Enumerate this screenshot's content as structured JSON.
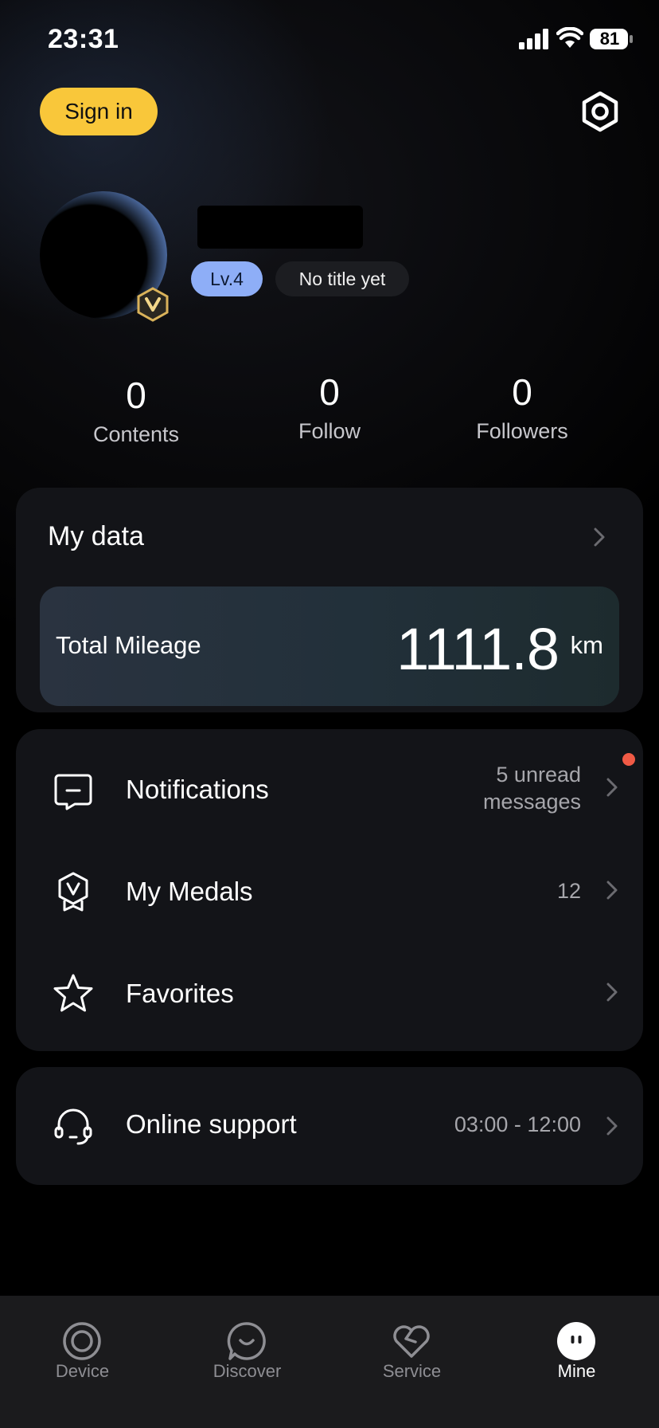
{
  "status_bar": {
    "time": "23:31",
    "battery": "81"
  },
  "header": {
    "sign_in_label": "Sign in",
    "settings_icon": "settings-icon"
  },
  "profile": {
    "level": "Lv.4",
    "title": "No title yet"
  },
  "stats": [
    {
      "value": "0",
      "label": "Contents"
    },
    {
      "value": "0",
      "label": "Follow"
    },
    {
      "value": "0",
      "label": "Followers"
    }
  ],
  "my_data": {
    "title": "My data",
    "mileage_label": "Total Mileage",
    "mileage_value": "1111.8",
    "mileage_unit": "km"
  },
  "menu": {
    "notifications": {
      "label": "Notifications",
      "value_line1": "5 unread",
      "value_line2": "messages",
      "icon": "message-icon",
      "has_unread_dot": true
    },
    "medals": {
      "label": "My Medals",
      "value": "12",
      "icon": "medal-icon"
    },
    "favorites": {
      "label": "Favorites",
      "value": "",
      "icon": "star-icon"
    }
  },
  "support": {
    "label": "Online support",
    "hours": "03:00 - 12:00",
    "icon": "headset-icon"
  },
  "bottom_nav": [
    {
      "label": "Device",
      "icon": "device-icon",
      "active": false
    },
    {
      "label": "Discover",
      "icon": "discover-icon",
      "active": false
    },
    {
      "label": "Service",
      "icon": "service-icon",
      "active": false
    },
    {
      "label": "Mine",
      "icon": "mine-icon",
      "active": true
    }
  ],
  "colors": {
    "accent_yellow": "#f9c73a",
    "level_blue": "#8eaef7",
    "unread_red": "#f05a45",
    "card_bg": "#131418"
  }
}
